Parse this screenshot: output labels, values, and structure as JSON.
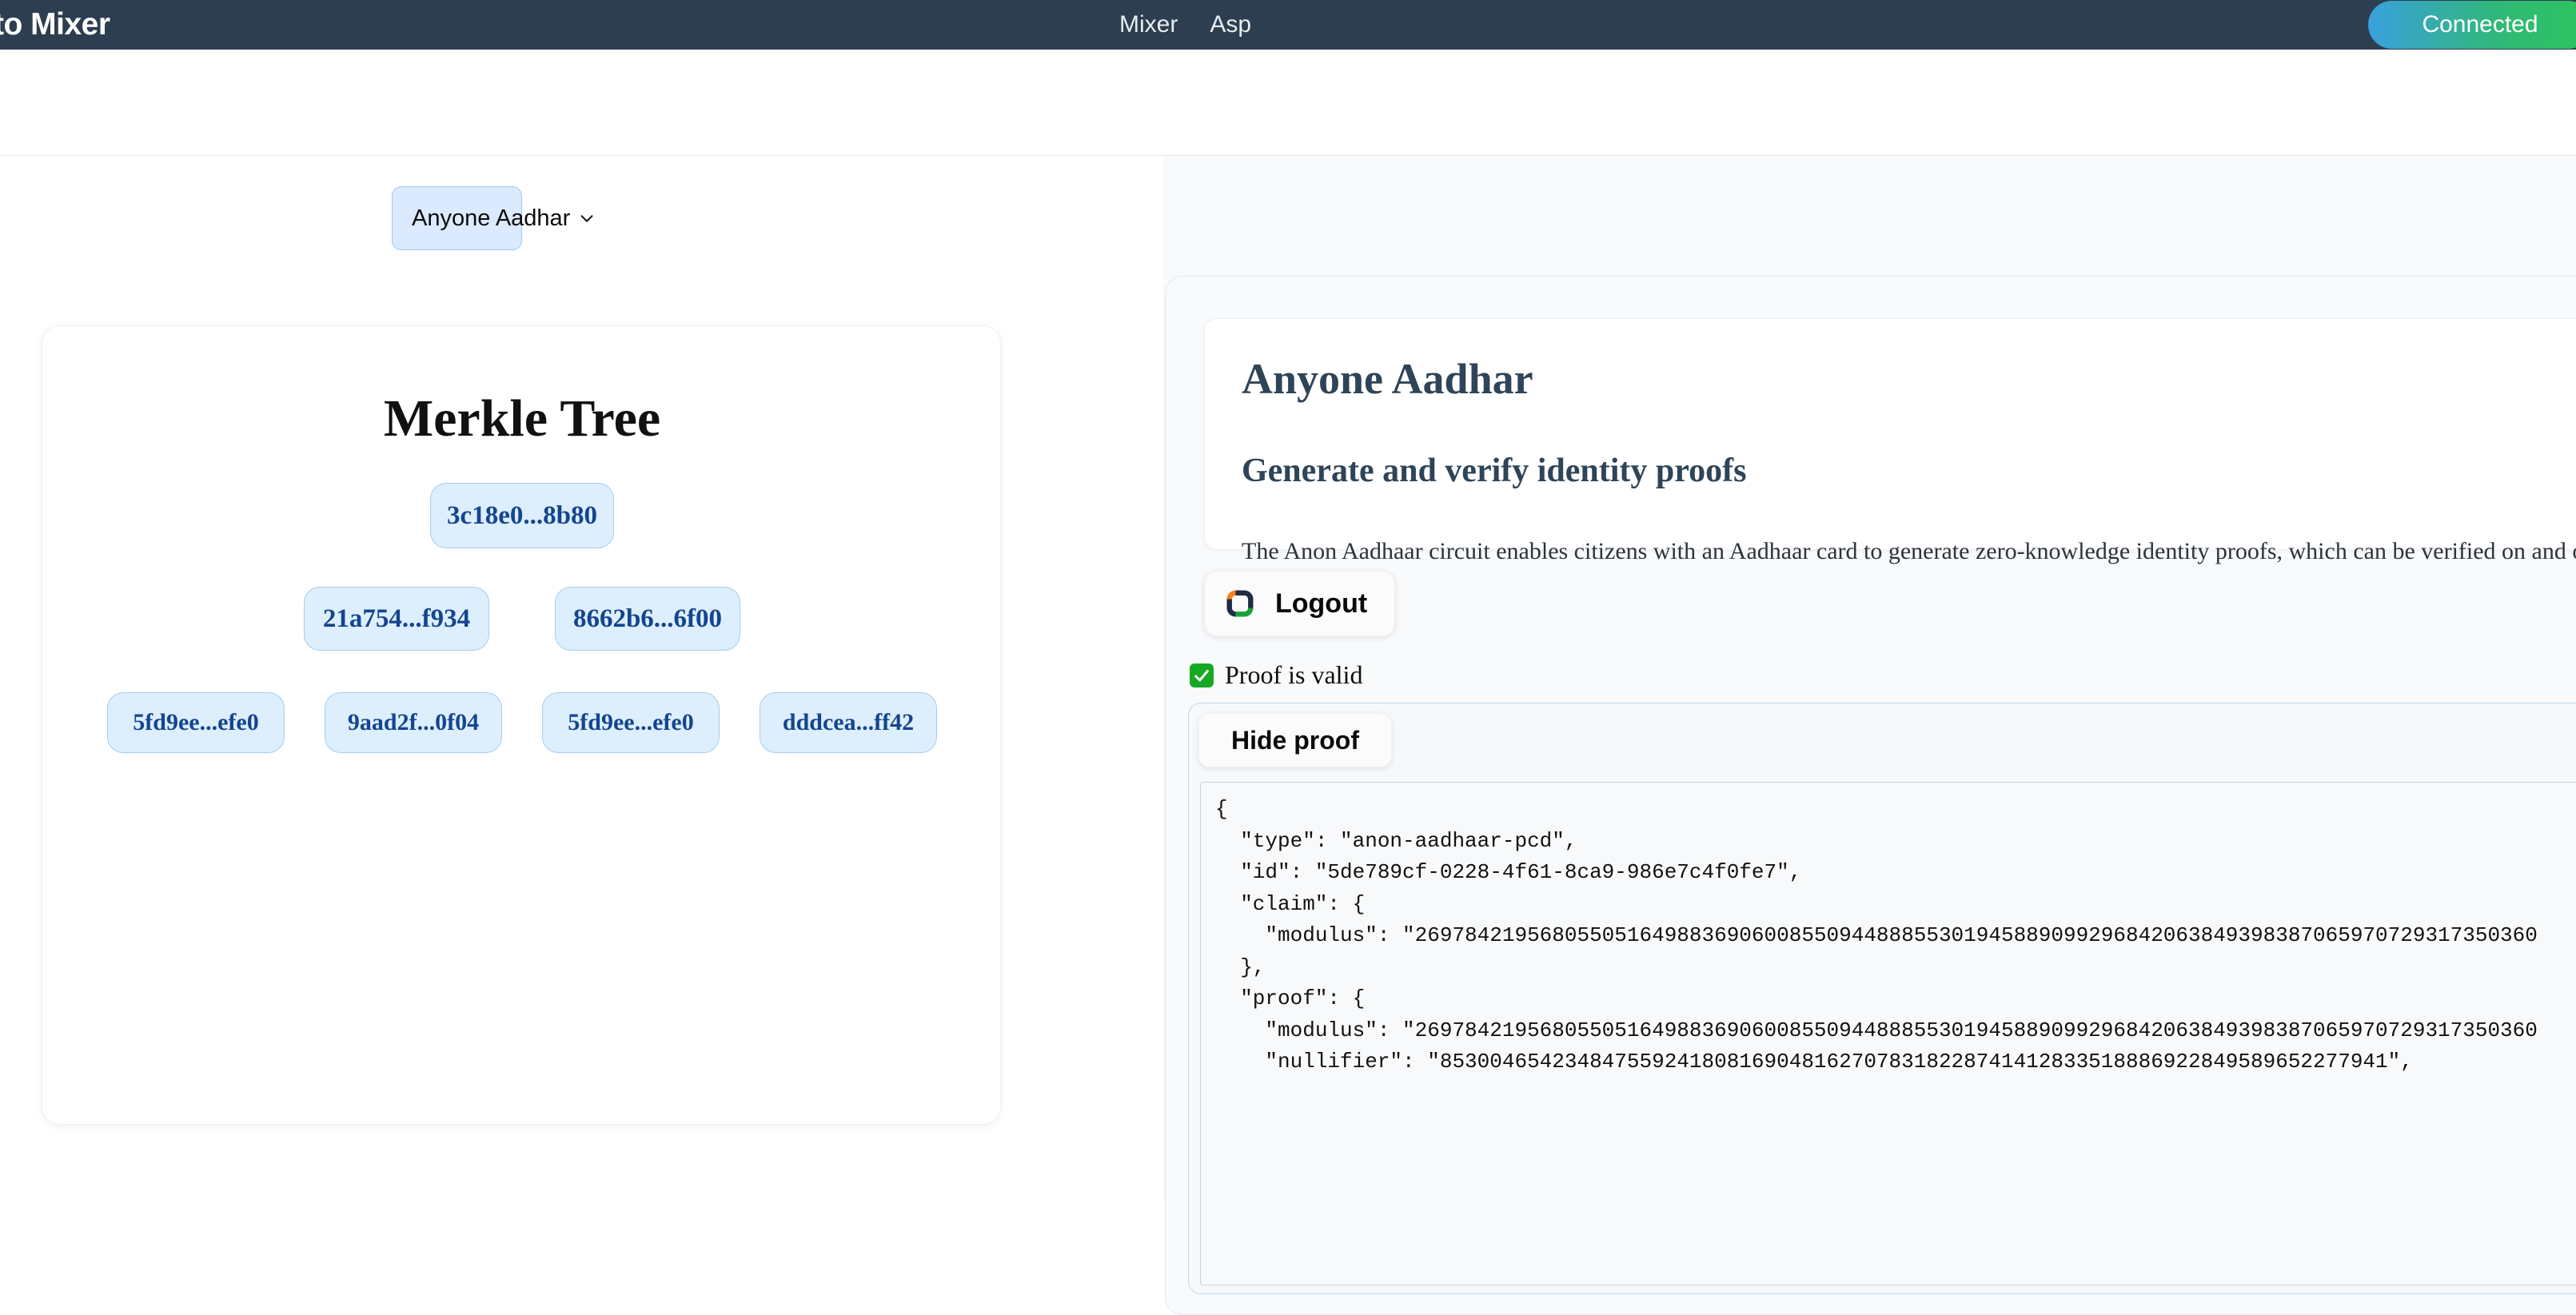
{
  "navbar": {
    "brand": "to Mixer",
    "links": [
      {
        "label": "Mixer"
      },
      {
        "label": "Asp"
      }
    ],
    "connected_label": "Connected",
    "bg_color": "#2c3e50",
    "connected_gradient_from": "#3aa0dd",
    "connected_gradient_to": "#2ec45f"
  },
  "left": {
    "type_select": {
      "value": "Anyone Aadhar",
      "options": [
        "Anyone Aadhar"
      ]
    },
    "merkle": {
      "title": "Merkle Tree",
      "levels": [
        [
          "3c18e0...8b80"
        ],
        [
          "21a754...f934",
          "8662b6...6f00"
        ],
        [
          "5fd9ee...efe0",
          "9aad2f...0f04",
          "5fd9ee...efe0",
          "dddcea...ff42"
        ]
      ],
      "node_bg": "#ddeefc",
      "node_border": "#a6cef0",
      "node_text": "#15458f"
    }
  },
  "right": {
    "info": {
      "heading": "Anyone Aadhar",
      "subheading": "Generate and verify identity proofs",
      "paragraph": "The Anon Aadhaar circuit enables citizens with an Aadhaar card to generate zero-knowledge identity proofs, which can be verified on and off the chain."
    },
    "logout": {
      "label": "Logout",
      "logo_colors": {
        "orange": "#f5821f",
        "navy": "#1f2a44",
        "green": "#1aa03c"
      }
    },
    "proof_status": {
      "icon": "white-check-mark",
      "text": "Proof is valid",
      "icon_color": "#16a822"
    },
    "proof_panel": {
      "toggle_label": "Hide proof",
      "code": "{\n  \"type\": \"anon-aadhaar-pcd\",\n  \"id\": \"5de789cf-0228-4f61-8ca9-986e7c4f0fe7\",\n  \"claim\": {\n    \"modulus\": \"269784219568055051649883690600855094488855301945889099296842063849398387065970729317350360\n  },\n  \"proof\": {\n    \"modulus\": \"269784219568055051649883690600855094488855301945889099296842063849398387065970729317350360\n    \"nullifier\": \"8530046542348475592418081690481627078318228741412833518886922849589652277941\","
    }
  }
}
